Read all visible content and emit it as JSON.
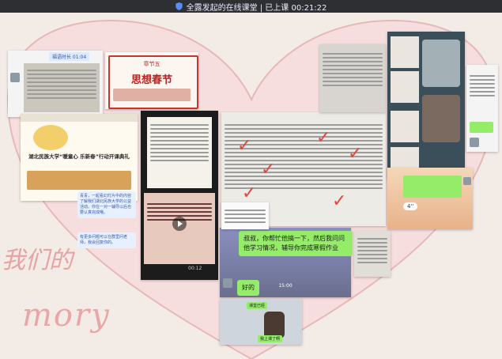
{
  "topbar": {
    "status_text": "全露发起的在线课堂 | 已上课 00:21:22",
    "icon": "shield-icon"
  },
  "decor": {
    "script_cn": "我们的",
    "script_en": "mory"
  },
  "cards": {
    "chat_top_label": "福语时长 01:04",
    "chapter_title": "章节五",
    "chapter_subtitle": "思想春节",
    "univ_banner": "湖北民族大学“暖童心 乐新春”行动开课典礼",
    "blue_note_1": "青青，一起看幻灯片中的内容了解我们湖北民族大学的公益活动。你在一对一辅导以后也要认真完成哦。",
    "blue_note_2": "有更多问题可以在群里问老师，我会回复你的。",
    "video_label": "00:12",
    "green_msg": "叔叔，你帮忙他搞一下，然后我问问他学习情况，辅导你完成寒假作业",
    "green_reply": "好的",
    "call_time": "15:00",
    "bottom_caption": "课堂已经",
    "bottom_caption_2": "我上课了啊",
    "side_time": "4''"
  }
}
